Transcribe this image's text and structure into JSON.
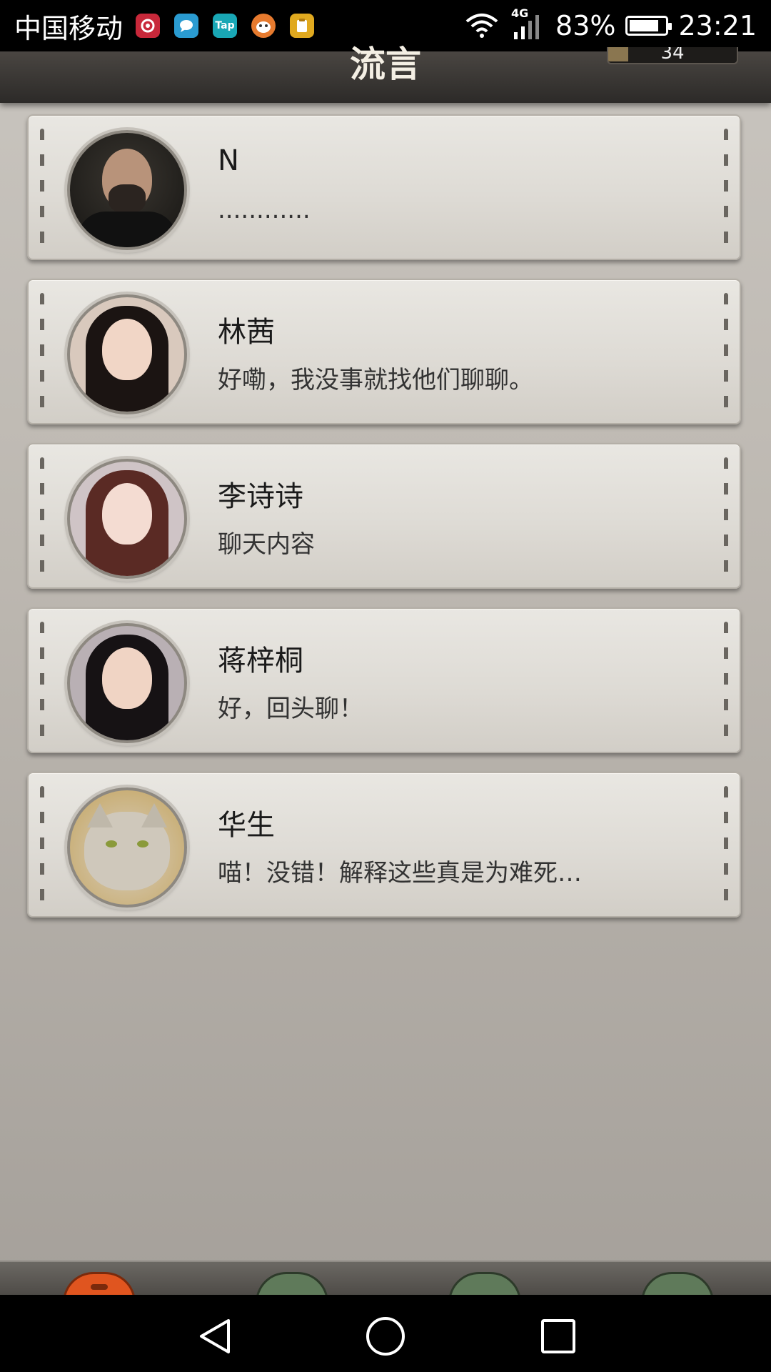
{
  "status_bar": {
    "carrier": "中国移动",
    "notif_icons": [
      "netease-music-icon",
      "message-icon",
      "taptap-icon",
      "fox-app-icon",
      "clipboard-app-icon"
    ],
    "tap_label": "Tap",
    "network": "4G",
    "battery_percent_text": "83%",
    "battery_level": 0.83,
    "time": "23:21"
  },
  "header": {
    "title": "流言",
    "counter": "34"
  },
  "conversations": [
    {
      "name": "N",
      "message": "............",
      "avatar": "man-portrait"
    },
    {
      "name": "林茜",
      "message": "好嘞，我没事就找他们聊聊。",
      "avatar": "woman-portrait"
    },
    {
      "name": "李诗诗",
      "message": "聊天内容",
      "avatar": "woman-portrait-anime-style"
    },
    {
      "name": "蒋梓桐",
      "message": "好，回头聊！",
      "avatar": "woman-portrait"
    },
    {
      "name": "华生",
      "message": "喵！没错！解释这些真是为难死…",
      "avatar": "cat-portrait"
    }
  ],
  "tabs": [
    {
      "name": "chat-tab",
      "active": true,
      "color": "#e0551f"
    },
    {
      "name": "tab-2",
      "active": false,
      "color": "#5f7a5a"
    },
    {
      "name": "tab-3",
      "active": false,
      "color": "#5f7a5a"
    },
    {
      "name": "tab-4",
      "active": false,
      "color": "#5f7a5a"
    }
  ],
  "nav": [
    "back-icon",
    "home-icon",
    "recents-icon"
  ]
}
